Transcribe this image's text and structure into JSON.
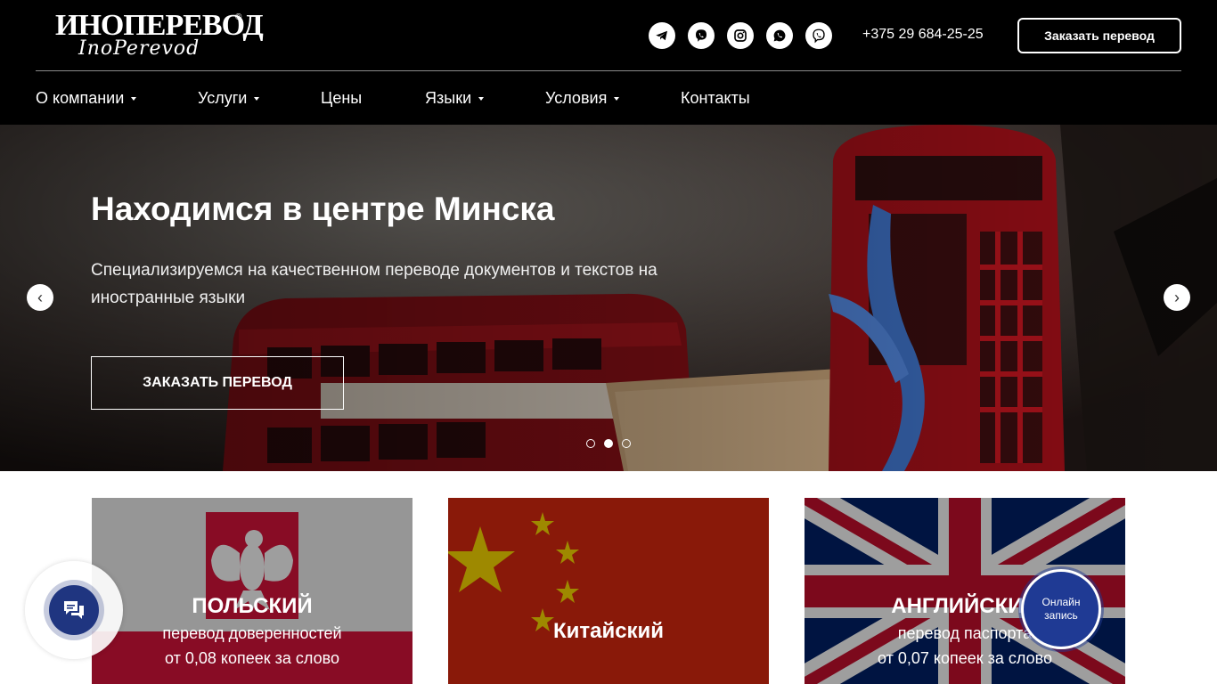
{
  "header": {
    "logo_main": "ИНОПЕРЕВОД",
    "logo_script": "InoPerevod",
    "logo_reg": "®",
    "socials": [
      "telegram-icon",
      "viber-icon",
      "instagram-icon",
      "whatsapp-icon",
      "viber-call-icon"
    ],
    "phone": "+375 29 684-25-25",
    "order_button": "Заказать перевод"
  },
  "nav": {
    "items": [
      {
        "label": "О компании",
        "dropdown": true
      },
      {
        "label": "Услуги",
        "dropdown": true
      },
      {
        "label": "Цены",
        "dropdown": false
      },
      {
        "label": "Языки",
        "dropdown": true
      },
      {
        "label": "Условия",
        "dropdown": true
      },
      {
        "label": "Контакты",
        "dropdown": false
      }
    ]
  },
  "hero": {
    "title": "Находимся в центре Минска",
    "subtitle": "Специализируемся на качественном переводе документов и текстов на иностранные языки",
    "button": "ЗАКАЗАТЬ ПЕРЕВОД",
    "prev_arrow": "‹",
    "next_arrow": "›",
    "slides": 3,
    "active_slide": 2
  },
  "cards": [
    {
      "title": "ПОЛЬСКИЙ",
      "line1": "перевод доверенностей",
      "line2": "от 0,08 копеек за слово"
    },
    {
      "title": "Китайский",
      "line1": "",
      "line2": ""
    },
    {
      "title": "АНГЛИЙСКИЙ",
      "line1": "перевод паспорта",
      "line2": "от 0,07 копеек за слово"
    }
  ],
  "widgets": {
    "online_line1": "Онлайн",
    "online_line2": "запись"
  },
  "colors": {
    "header_bg": "#000000",
    "accent_blue": "#1f3a94",
    "poland_red": "#dc143c",
    "china_red": "#de2910",
    "uk_blue": "#012169"
  }
}
